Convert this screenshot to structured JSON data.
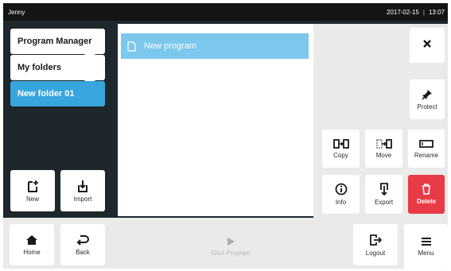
{
  "status_bar": {
    "user": "Jenny",
    "date": "2017-02-15",
    "separator": "|",
    "time": "13:07"
  },
  "folders": {
    "items": [
      {
        "label": "Program Manager"
      },
      {
        "label": "My folders"
      },
      {
        "label": "New folder 01"
      }
    ]
  },
  "left_actions": {
    "new_label": "New",
    "import_label": "Import"
  },
  "programs": {
    "items": [
      {
        "label": "New program"
      }
    ]
  },
  "right_actions": {
    "protect_label": "Protect",
    "copy_label": "Copy",
    "move_label": "Move",
    "rename_label": "Rename",
    "info_label": "Info",
    "export_label": "Export",
    "delete_label": "Delete"
  },
  "bottom_bar": {
    "home_label": "Home",
    "back_label": "Back",
    "start_label": "Start Program",
    "logout_label": "Logout",
    "menu_label": "Menu"
  },
  "colors": {
    "accent": "#36a6dc",
    "selected_program": "#7cc7ec",
    "danger": "#e83b47",
    "background_dark": "#1e272b"
  },
  "icons": {
    "close": "close-icon",
    "protect": "pin-icon",
    "copy": "copy-icon",
    "move": "move-icon",
    "rename": "rename-icon",
    "info": "info-icon",
    "export": "export-icon",
    "delete": "trash-icon",
    "new": "new-file-icon",
    "import": "import-icon",
    "home": "home-icon",
    "back": "back-arrow-icon",
    "start": "play-icon",
    "logout": "logout-icon",
    "menu": "hamburger-icon",
    "program": "document-icon"
  }
}
